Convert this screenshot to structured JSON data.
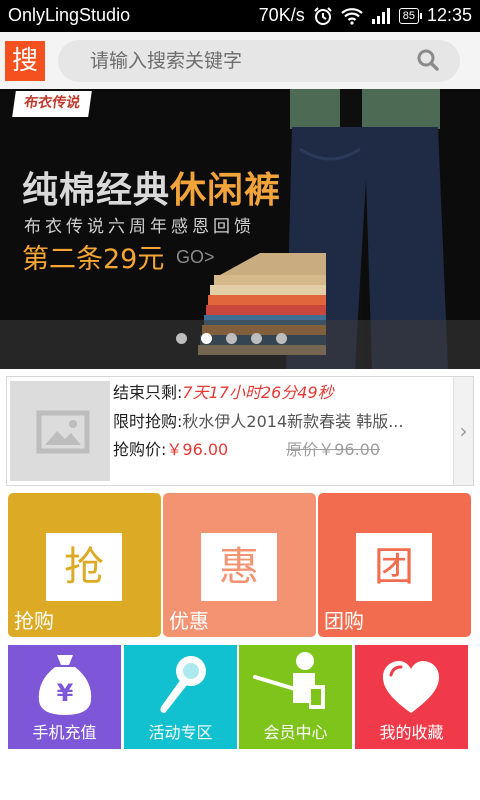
{
  "status_bar": {
    "app_name": "OnlyLingStudio",
    "speed": "70K/s",
    "battery": "85",
    "time": "12:35"
  },
  "search": {
    "logo_char": "搜",
    "placeholder": "请输入搜索关键字",
    "icon": "search-icon"
  },
  "banner": {
    "brand": "布衣传说",
    "title_a": "纯棉经典",
    "title_b": "休闲裤",
    "subtitle": "布衣传说六周年感恩回馈",
    "promo": "第二条29元",
    "go": "GO>",
    "dots_count": 5,
    "active_dot": 1
  },
  "flash_sale": {
    "ends_label": "结束只剩:",
    "countdown": "7天17小时26分49秒",
    "title_label": "限时抢购:",
    "title": "秋水伊人2014新款春装 韩版...",
    "price_label": "抢购价:",
    "price": "￥96.00",
    "original_price": "原价￥96.00",
    "thumb_icon": "image-placeholder-icon",
    "arrow": "›"
  },
  "tiles": [
    {
      "char": "抢",
      "label": "抢购",
      "color": "#dcaa24"
    },
    {
      "char": "惠",
      "label": "优惠",
      "color": "#f49372"
    },
    {
      "char": "团",
      "label": "团购",
      "color": "#f26d4f"
    }
  ],
  "categories": [
    {
      "label": "手机充值",
      "color": "#7e56d8",
      "icon": "money-bag-icon"
    },
    {
      "label": "活动专区",
      "color": "#12c1cf",
      "icon": "flashlight-icon"
    },
    {
      "label": "会员中心",
      "color": "#7fc41a",
      "icon": "teacher-board-icon"
    },
    {
      "label": "我的收藏",
      "color": "#f03a4a",
      "icon": "heart-icon"
    }
  ]
}
